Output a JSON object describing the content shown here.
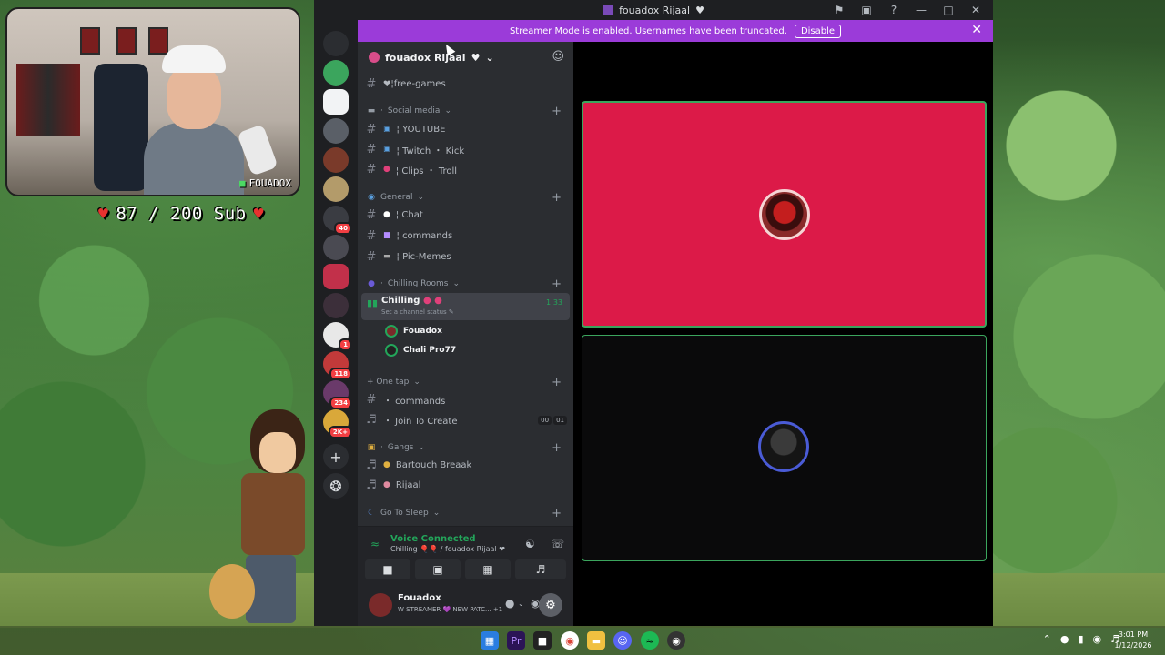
{
  "window": {
    "title": "fouadox Rijaal"
  },
  "banner": {
    "text": "Streamer Mode is enabled. Usernames have been truncated.",
    "disable_label": "Disable"
  },
  "server": {
    "name": "fouadox Rijaal"
  },
  "overlay": {
    "cam_tag": "FOUADOX",
    "sub_goal": "87 / 200 Sub"
  },
  "channels": {
    "free_games": "❤¦free-games",
    "cat_social": "Social media",
    "youtube": "¦ YOUTUBE",
    "twitch": "¦ Twitch ・ Kick",
    "clips": "¦ Clips ・ Troll",
    "cat_general": "General",
    "chat": "¦ Chat",
    "commands": "¦ commands",
    "pic_memes": "¦ Pic-Memes",
    "cat_chilling": "Chilling Rooms",
    "chilling_name": "Chilling",
    "chilling_status": "Set a channel status",
    "chilling_time": "1:33",
    "user1": "Fouadox",
    "user2": "Chali Pro77",
    "cat_onetap": "+ One tap",
    "onetap_commands": "・ commands",
    "join_create": "・ Join To Create",
    "jc_pill1": "00",
    "jc_pill2": "01",
    "cat_gangs": "Gangs",
    "bartouch": "Bartouch Breaak",
    "rijaal": "Rijaal",
    "cat_sleep": "Go To Sleep"
  },
  "servers": {
    "badge_40": "40",
    "badge_1": "1",
    "badge_118": "118",
    "badge_234": "234",
    "badge_2k": "2K+"
  },
  "voice": {
    "title": "Voice Connected",
    "subtitle": "Chilling 🎈🎈 / fouadox Rijaal ❤"
  },
  "user": {
    "name": "Fouadox",
    "status": "W STREAMER 💜 NEW PATC...",
    "status_extra": "+1"
  },
  "clock": {
    "time": "3:01 PM",
    "date": "1/12/2026"
  },
  "colors": {
    "accent_purple": "#9b3bd9",
    "voice_green": "#23a55a",
    "tile_red": "#dc1a48",
    "alert_red": "#f23f43"
  }
}
